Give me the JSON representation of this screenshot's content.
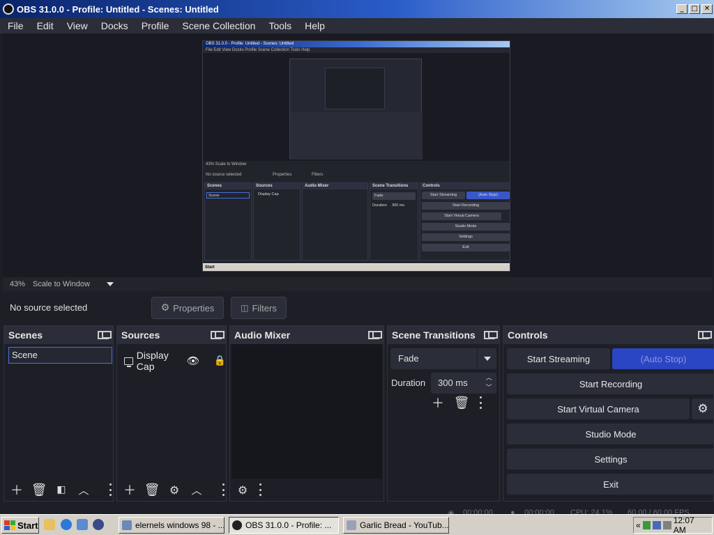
{
  "window": {
    "title": "OBS 31.0.0 - Profile: Untitled - Scenes: Untitled",
    "minimize": "_",
    "maximize": "□",
    "close": "✕"
  },
  "menu": [
    "File",
    "Edit",
    "View",
    "Docks",
    "Profile",
    "Scene Collection",
    "Tools",
    "Help"
  ],
  "preview": {
    "nested": {
      "title": "OBS 31.0.0 - Profile: Untitled - Scenes: Untitled",
      "menu": "File   Edit   View   Docks   Profile   Scene Collection   Tools   Help",
      "zoom": "43%   Scale to Window",
      "no_source": "No source selected",
      "properties": "Properties",
      "filters": "Filters",
      "docks": [
        "Scenes",
        "Sources",
        "Audio Mixer",
        "Scene Transitions",
        "Controls"
      ],
      "scene": "Scene",
      "source": "Display Cap",
      "fade": "Fade",
      "duration": "Duration",
      "duration_value": "300 ms",
      "controls": [
        "Start Streaming",
        "(Auto Stop)",
        "Start Recording",
        "Start Virtual Camera",
        "Studio Mode",
        "Settings",
        "Exit"
      ],
      "taskbar": "Start"
    }
  },
  "zoombar": {
    "zoom": "43%",
    "scale": "Scale to Window"
  },
  "context": {
    "no_source": "No source selected",
    "properties": "Properties",
    "filters": "Filters"
  },
  "docks": {
    "scenes": {
      "title": "Scenes",
      "items": [
        "Scene"
      ]
    },
    "sources": {
      "title": "Sources",
      "items": [
        "Display Cap"
      ]
    },
    "mixer": {
      "title": "Audio Mixer"
    },
    "transitions": {
      "title": "Scene Transitions",
      "transition": "Fade",
      "duration_label": "Duration",
      "duration_value": "300 ms"
    },
    "controls": {
      "title": "Controls",
      "start_streaming": "Start Streaming",
      "auto_stop": "(Auto Stop)",
      "start_recording": "Start Recording",
      "start_virtual_camera": "Start Virtual Camera",
      "studio_mode": "Studio Mode",
      "settings": "Settings",
      "exit": "Exit"
    }
  },
  "statusbar": {
    "stream_time": "00:00:00",
    "rec_time": "00:00:00",
    "cpu": "CPU: 24.1%",
    "fps": "60.00 / 60.00 FPS"
  },
  "taskbar": {
    "start": "Start",
    "tasks": [
      {
        "label": "elernels windows 98 - ..."
      },
      {
        "label": "OBS 31.0.0 - Profile: ..."
      },
      {
        "label": "Garlic Bread - YouTub..."
      }
    ],
    "tray_chevron": "«",
    "clock": "12:07 AM"
  },
  "colors": {
    "accent": "#2b46c4",
    "panel": "#2b2e38",
    "background": "#1e1f26"
  }
}
